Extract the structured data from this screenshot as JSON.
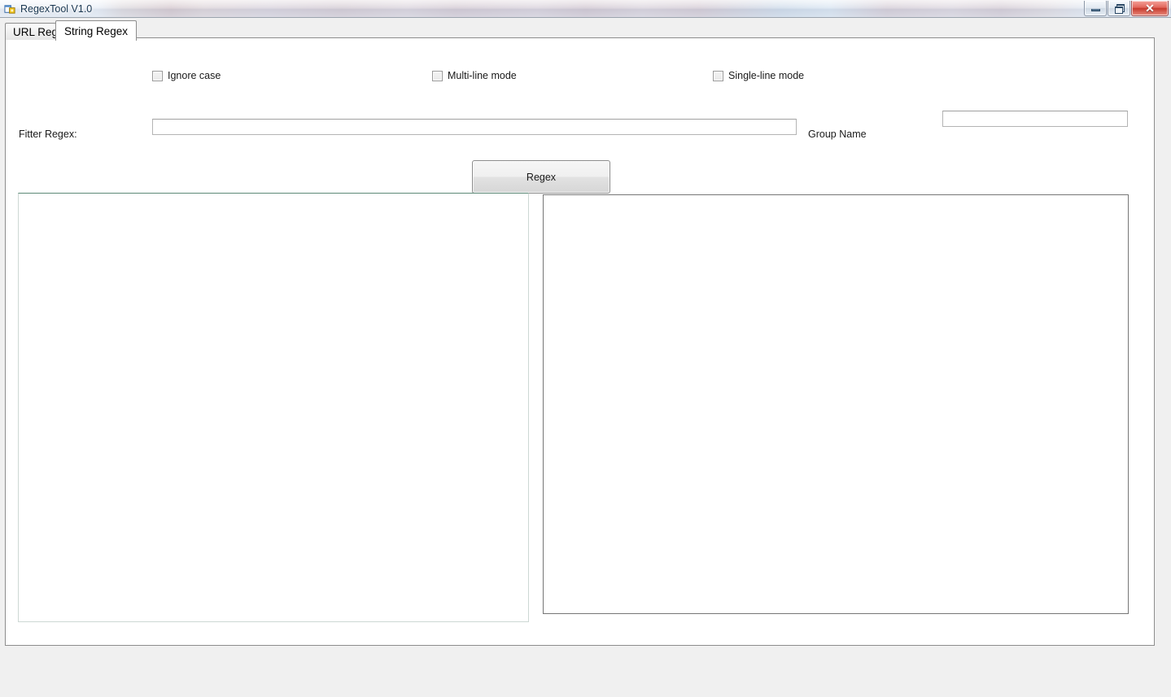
{
  "window": {
    "title": "RegexTool V1.0",
    "icon": "form-designer-icon",
    "controls": {
      "minimize_label": "",
      "restore_label": "",
      "close_label": "✕"
    }
  },
  "tabs": [
    {
      "id": "url-regex",
      "label": "URL Regex",
      "active": false
    },
    {
      "id": "string-regex",
      "label": "String Regex",
      "active": true
    }
  ],
  "options": {
    "ignore_case": {
      "label": "Ignore case",
      "checked": false
    },
    "multi_line": {
      "label": "Multi-line mode",
      "checked": false
    },
    "single_line": {
      "label": "Single-line mode",
      "checked": false
    }
  },
  "filter_row": {
    "label": "Fitter Regex:",
    "regex_value": "",
    "regex_placeholder": "",
    "group_name_label": "Group Name",
    "group_name_value": "",
    "group_name_placeholder": ""
  },
  "actions": {
    "regex_button": "Regex"
  },
  "panes": {
    "input_text": "",
    "input_placeholder": "",
    "output_text": "",
    "output_placeholder": ""
  },
  "colors": {
    "accent_border_left_pane": "#5d8a78",
    "border_right_pane": "#767676",
    "close_button": "#c63a2d",
    "form_background": "#f0f0f0"
  }
}
